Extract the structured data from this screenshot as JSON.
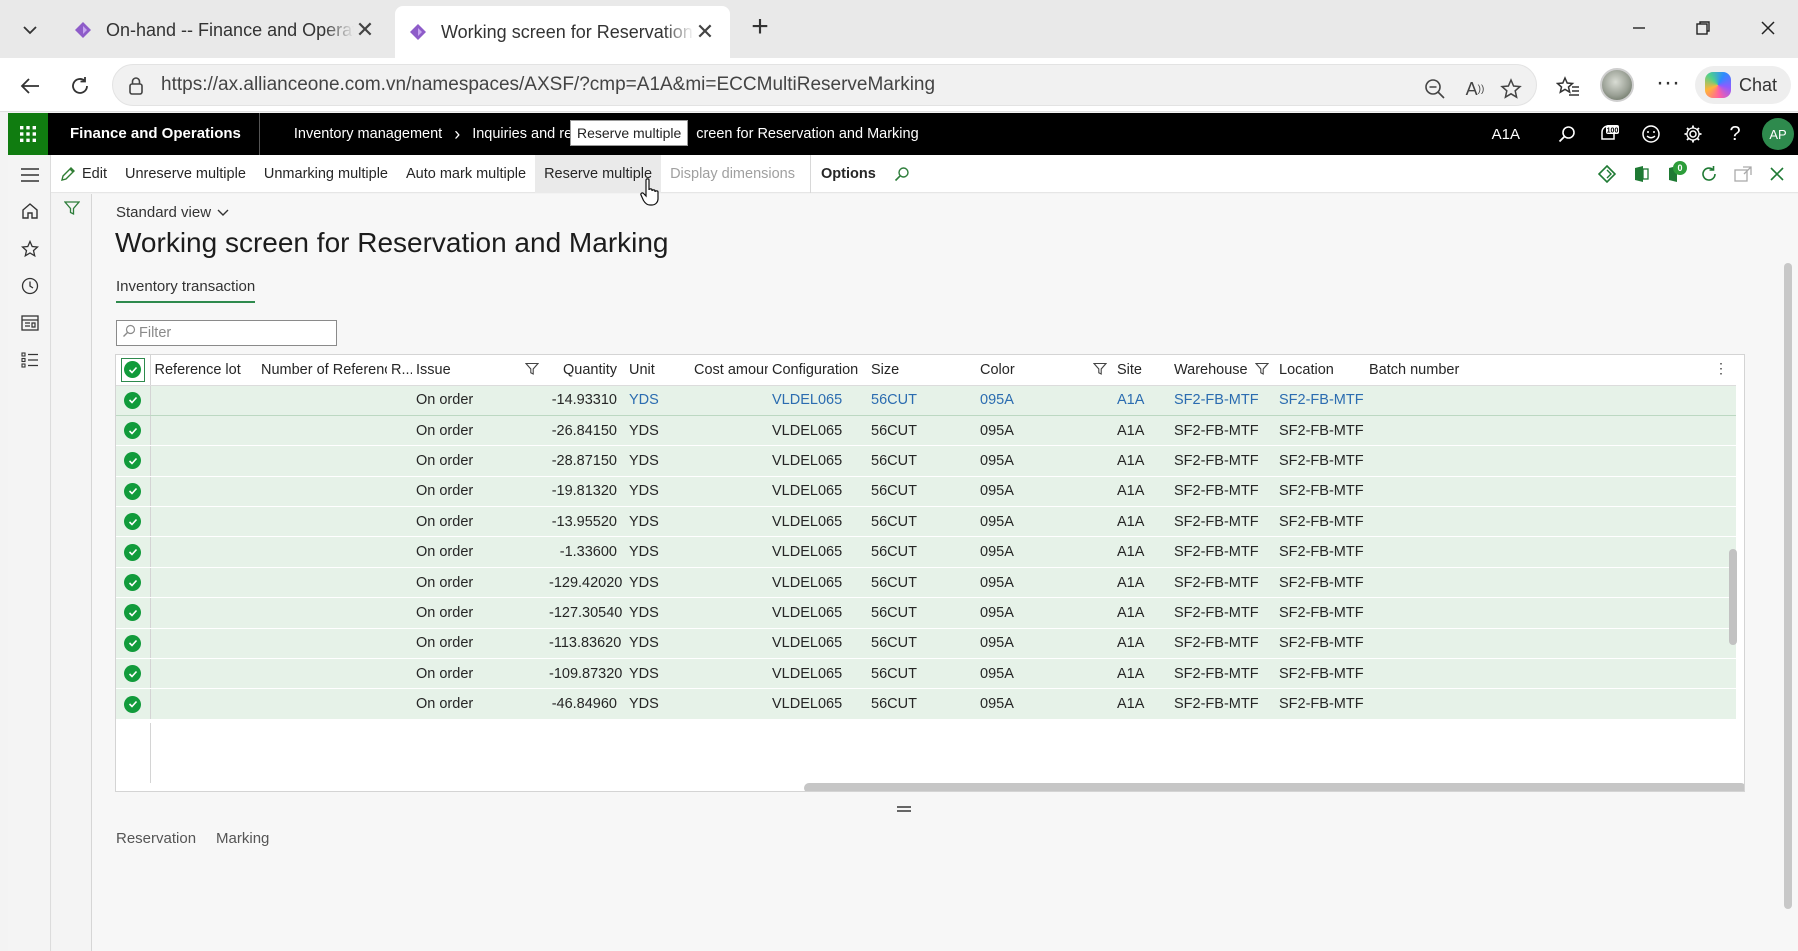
{
  "browser": {
    "tabs": [
      {
        "title": "On-hand -- Finance and Operations",
        "active": false
      },
      {
        "title": "Working screen for Reservation and Marking",
        "active": true
      }
    ],
    "url": "https://ax.allianceone.com.vn/namespaces/AXSF/?cmp=A1A&mi=ECCMultiReserveMarking",
    "copilot_label": "Chat"
  },
  "navbar": {
    "app_name": "Finance and Operations",
    "breadcrumbs": [
      "Inventory management",
      "Inquiries and rep",
      "creen for Reservation and Marking"
    ],
    "company": "A1A",
    "avatar_initials": "AP"
  },
  "tooltip": "Reserve multiple",
  "actions": {
    "edit": "Edit",
    "unreserve": "Unreserve multiple",
    "unmarking": "Unmarking multiple",
    "automark": "Auto mark multiple",
    "reserve": "Reserve multiple",
    "display_dimensions": "Display dimensions",
    "options": "Options"
  },
  "page": {
    "view_selector": "Standard view",
    "title": "Working screen for Reservation and Marking",
    "tab": "Inventory transaction",
    "filter_placeholder": "Filter"
  },
  "grid": {
    "columns": [
      "Reference lot",
      "Number of Referenc...",
      "R...",
      "Issue",
      "Quantity",
      "Unit",
      "Cost amount",
      "Configuration",
      "Size",
      "Color",
      "Site",
      "Warehouse",
      "Location",
      "Batch number"
    ],
    "rows": [
      {
        "issue": "On order",
        "quantity": "-14.93310",
        "unit": "YDS",
        "configuration": "VLDEL065",
        "size": "56CUT",
        "color": "095A",
        "site": "A1A",
        "warehouse": "SF2-FB-MTF",
        "location": "SF2-FB-MTF"
      },
      {
        "issue": "On order",
        "quantity": "-26.84150",
        "unit": "YDS",
        "configuration": "VLDEL065",
        "size": "56CUT",
        "color": "095A",
        "site": "A1A",
        "warehouse": "SF2-FB-MTF",
        "location": "SF2-FB-MTF"
      },
      {
        "issue": "On order",
        "quantity": "-28.87150",
        "unit": "YDS",
        "configuration": "VLDEL065",
        "size": "56CUT",
        "color": "095A",
        "site": "A1A",
        "warehouse": "SF2-FB-MTF",
        "location": "SF2-FB-MTF"
      },
      {
        "issue": "On order",
        "quantity": "-19.81320",
        "unit": "YDS",
        "configuration": "VLDEL065",
        "size": "56CUT",
        "color": "095A",
        "site": "A1A",
        "warehouse": "SF2-FB-MTF",
        "location": "SF2-FB-MTF"
      },
      {
        "issue": "On order",
        "quantity": "-13.95520",
        "unit": "YDS",
        "configuration": "VLDEL065",
        "size": "56CUT",
        "color": "095A",
        "site": "A1A",
        "warehouse": "SF2-FB-MTF",
        "location": "SF2-FB-MTF"
      },
      {
        "issue": "On order",
        "quantity": "-1.33600",
        "unit": "YDS",
        "configuration": "VLDEL065",
        "size": "56CUT",
        "color": "095A",
        "site": "A1A",
        "warehouse": "SF2-FB-MTF",
        "location": "SF2-FB-MTF"
      },
      {
        "issue": "On order",
        "quantity": "-129.42020",
        "unit": "YDS",
        "configuration": "VLDEL065",
        "size": "56CUT",
        "color": "095A",
        "site": "A1A",
        "warehouse": "SF2-FB-MTF",
        "location": "SF2-FB-MTF"
      },
      {
        "issue": "On order",
        "quantity": "-127.30540",
        "unit": "YDS",
        "configuration": "VLDEL065",
        "size": "56CUT",
        "color": "095A",
        "site": "A1A",
        "warehouse": "SF2-FB-MTF",
        "location": "SF2-FB-MTF"
      },
      {
        "issue": "On order",
        "quantity": "-113.83620",
        "unit": "YDS",
        "configuration": "VLDEL065",
        "size": "56CUT",
        "color": "095A",
        "site": "A1A",
        "warehouse": "SF2-FB-MTF",
        "location": "SF2-FB-MTF"
      },
      {
        "issue": "On order",
        "quantity": "-109.87320",
        "unit": "YDS",
        "configuration": "VLDEL065",
        "size": "56CUT",
        "color": "095A",
        "site": "A1A",
        "warehouse": "SF2-FB-MTF",
        "location": "SF2-FB-MTF"
      },
      {
        "issue": "On order",
        "quantity": "-46.84960",
        "unit": "YDS",
        "configuration": "VLDEL065",
        "size": "56CUT",
        "color": "095A",
        "site": "A1A",
        "warehouse": "SF2-FB-MTF",
        "location": "SF2-FB-MTF"
      }
    ]
  },
  "bottom_tabs": [
    "Reservation",
    "Marking"
  ],
  "colors": {
    "brand_green": "#107c10",
    "check_green": "#119b3b",
    "selected_row": "#e6f2e8",
    "link_blue": "#2b6cb0"
  }
}
